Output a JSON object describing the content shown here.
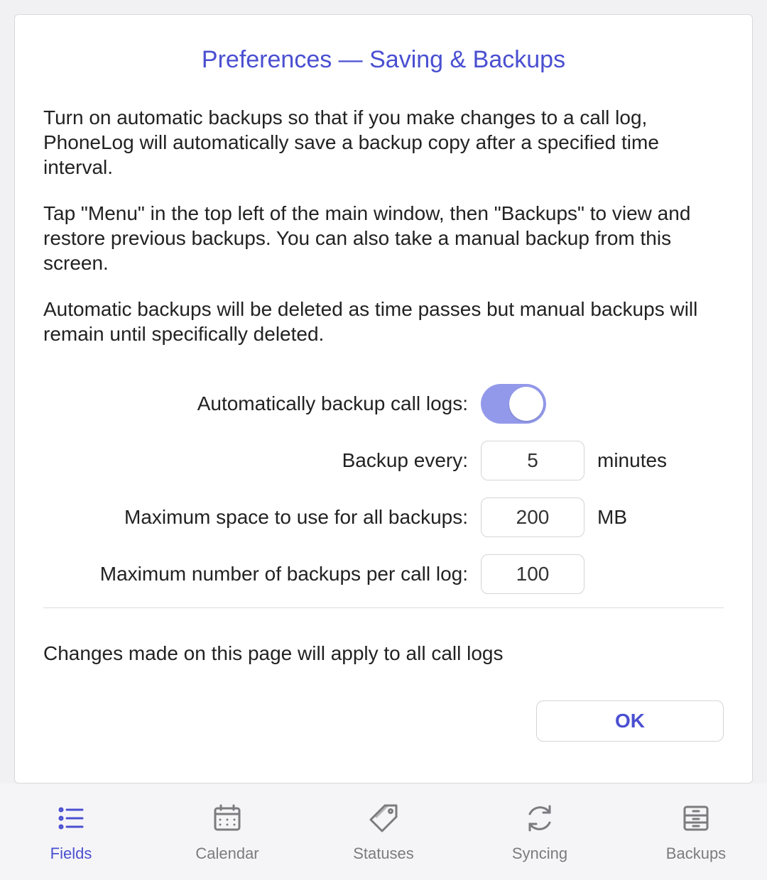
{
  "title": "Preferences — Saving & Backups",
  "paragraphs": {
    "p1": "Turn on automatic backups so that if you make changes to a call log, PhoneLog will automatically save a backup copy after a specified time interval.",
    "p2": "Tap \"Menu\" in the top left of the main window, then \"Backups\" to view and restore previous backups. You can also take a manual backup from this screen.",
    "p3": "Automatic backups will be deleted as time passes but manual backups will remain until specifically deleted."
  },
  "form": {
    "auto_backup_label": "Automatically backup call logs:",
    "auto_backup_on": true,
    "backup_every_label": "Backup every:",
    "backup_every_value": "5",
    "backup_every_unit": "minutes",
    "max_space_label": "Maximum space to use for all backups:",
    "max_space_value": "200",
    "max_space_unit": "MB",
    "max_number_label": "Maximum number of backups per call log:",
    "max_number_value": "100"
  },
  "footer_note": "Changes made on this page will apply to all call logs",
  "ok_label": "OK",
  "tabs": {
    "fields": "Fields",
    "calendar": "Calendar",
    "statuses": "Statuses",
    "syncing": "Syncing",
    "backups": "Backups"
  }
}
